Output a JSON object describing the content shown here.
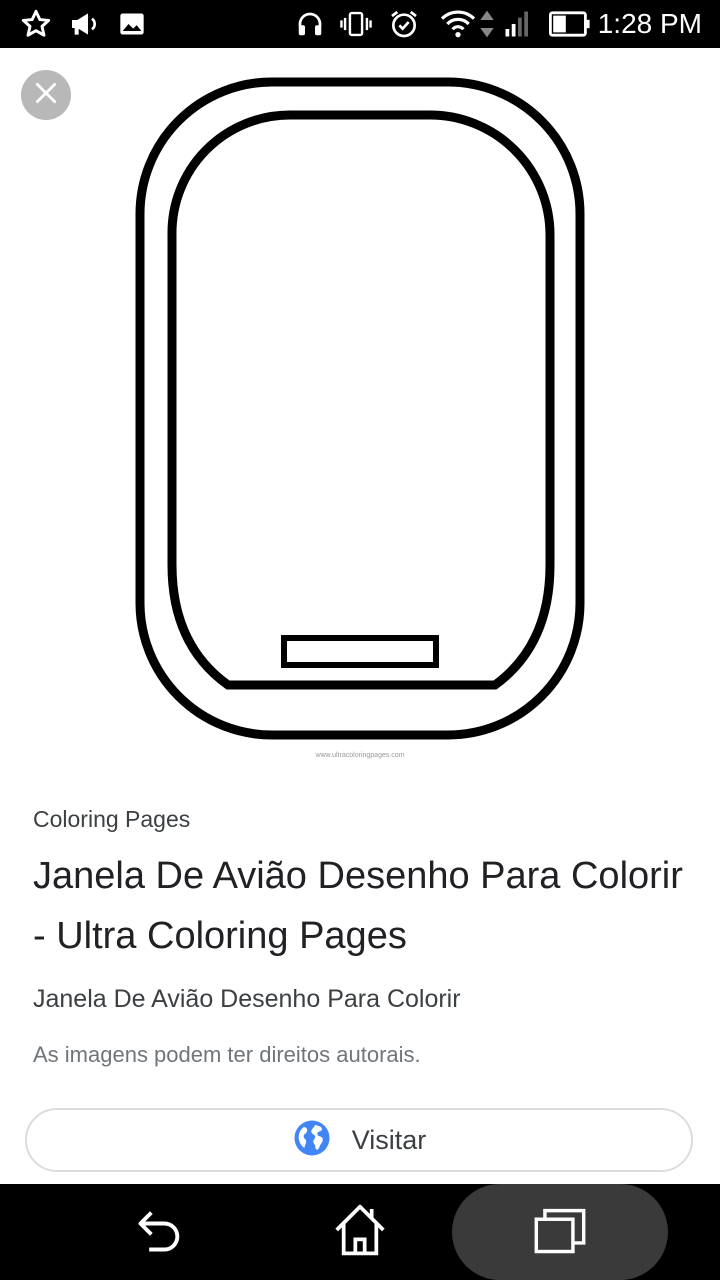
{
  "status_bar": {
    "time": "1:28 PM",
    "left_icons": [
      "star-icon",
      "megaphone-icon",
      "image-icon"
    ],
    "right_icons": [
      "headset-icon",
      "vibrate-icon",
      "alarm-icon",
      "wifi-icon",
      "data-arrows-icon",
      "signal-icon",
      "battery-icon"
    ]
  },
  "image_panel": {
    "close_icon": "close-icon",
    "preview_watermark": "www.ultracoloringpages.com"
  },
  "result": {
    "source": "Coloring Pages",
    "title": "Janela De Avião Desenho Para Colorir - Ultra Coloring Pages",
    "subtitle": "Janela De Avião Desenho Para Colorir",
    "copyright_notice": "As imagens podem ter direitos autorais.",
    "visit_label": "Visitar",
    "visit_icon": "globe-icon"
  },
  "nav_bar": {
    "icons": [
      "back-icon",
      "home-icon",
      "recents-icon"
    ]
  },
  "colors": {
    "globe_blue": "#4285f4",
    "close_bg": "#b8b8b8",
    "bar_bg": "#000000"
  }
}
